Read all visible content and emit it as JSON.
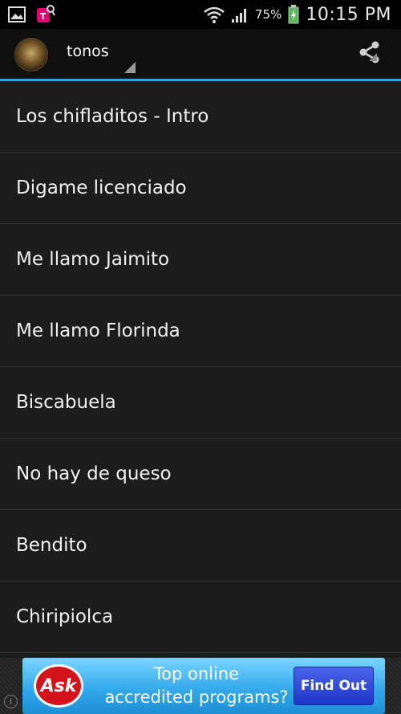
{
  "status_bar": {
    "icons": [
      "image-icon",
      "tmobile-icon",
      "wifi-icon",
      "signal-icon",
      "battery-charging-icon"
    ],
    "battery": "75%",
    "time": "10:15 PM"
  },
  "action_bar": {
    "title": "tonos",
    "accent_color": "#35a3d6",
    "icons": [
      "app-avatar-icon",
      "share-icon"
    ]
  },
  "list": {
    "items": [
      {
        "label": "Los chifladitos - Intro"
      },
      {
        "label": "Digame licenciado"
      },
      {
        "label": "Me llamo Jaimito"
      },
      {
        "label": "Me llamo Florinda"
      },
      {
        "label": "Biscabuela"
      },
      {
        "label": "No hay de queso"
      },
      {
        "label": "Bendito"
      },
      {
        "label": "Chiripiolca"
      }
    ]
  },
  "ad": {
    "logo_text": "Ask",
    "copy_line1": "Top online",
    "copy_line2": "accredited programs?",
    "button_label": "Find Out",
    "info_glyph": "i"
  }
}
